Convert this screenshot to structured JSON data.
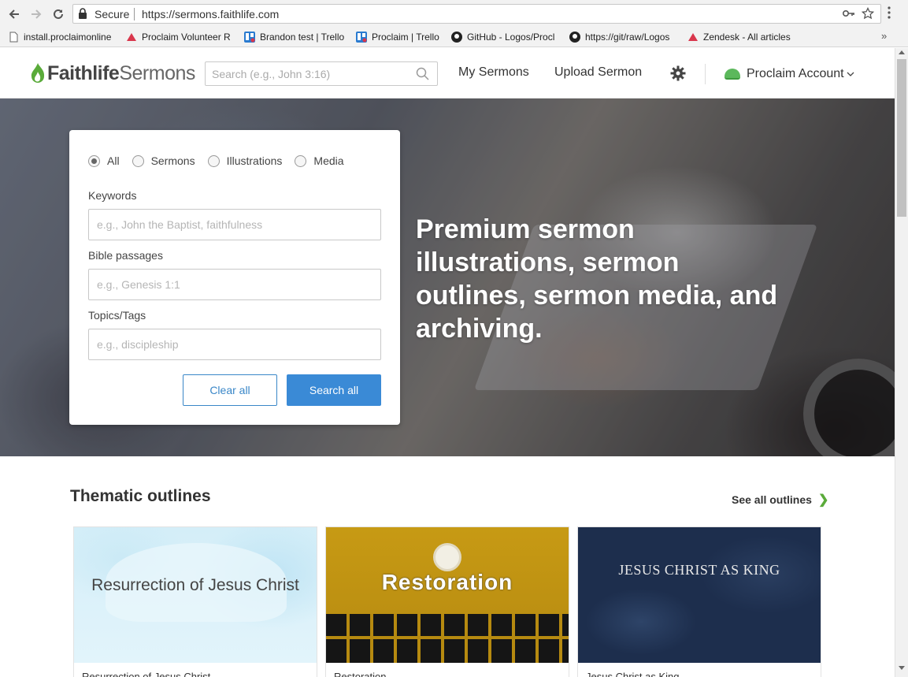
{
  "browser": {
    "secure_label": "Secure",
    "url": "https://sermons.faithlife.com",
    "bookmarks": [
      {
        "label": "install.proclaimonline",
        "icon": "page-icon"
      },
      {
        "label": "Proclaim Volunteer R",
        "icon": "proclaim-icon"
      },
      {
        "label": "Brandon test | Trello",
        "icon": "trello-icon"
      },
      {
        "label": "Proclaim | Trello",
        "icon": "trello-icon"
      },
      {
        "label": "GitHub - Logos/Procl",
        "icon": "github-icon"
      },
      {
        "label": "https://git/raw/Logos",
        "icon": "github-icon"
      },
      {
        "label": "Zendesk - All articles",
        "icon": "zendesk-icon"
      }
    ],
    "more_label": "»"
  },
  "header": {
    "logo_word1": "Faithlife",
    "logo_word2": "Sermons",
    "search_placeholder": "Search (e.g., John 3:16)",
    "nav": {
      "my_sermons": "My Sermons",
      "upload_sermon": "Upload Sermon",
      "account": "Proclaim Account"
    },
    "accent": "#5cb85c"
  },
  "hero": {
    "title": "Premium sermon illustrations, sermon outlines, sermon media, and archiving."
  },
  "search_form": {
    "filters": [
      {
        "label": "All",
        "selected": true
      },
      {
        "label": "Sermons",
        "selected": false
      },
      {
        "label": "Illustrations",
        "selected": false
      },
      {
        "label": "Media",
        "selected": false
      }
    ],
    "keywords_label": "Keywords",
    "keywords_placeholder": "e.g., John the Baptist, faithfulness",
    "bible_label": "Bible passages",
    "bible_placeholder": "e.g., Genesis 1:1",
    "topics_label": "Topics/Tags",
    "topics_placeholder": "e.g., discipleship",
    "clear_label": "Clear all",
    "search_label": "Search all",
    "primary_color": "#3a8ad6"
  },
  "outlines": {
    "title": "Thematic outlines",
    "see_all": "See all outlines",
    "cards": [
      {
        "image_text": "Resurrection of Jesus Christ",
        "caption": "Resurrection of Jesus Christ"
      },
      {
        "image_text": "Restoration",
        "caption": "Restoration"
      },
      {
        "image_text": "JESUS CHRIST AS KING",
        "caption": "Jesus Christ as King"
      }
    ]
  }
}
